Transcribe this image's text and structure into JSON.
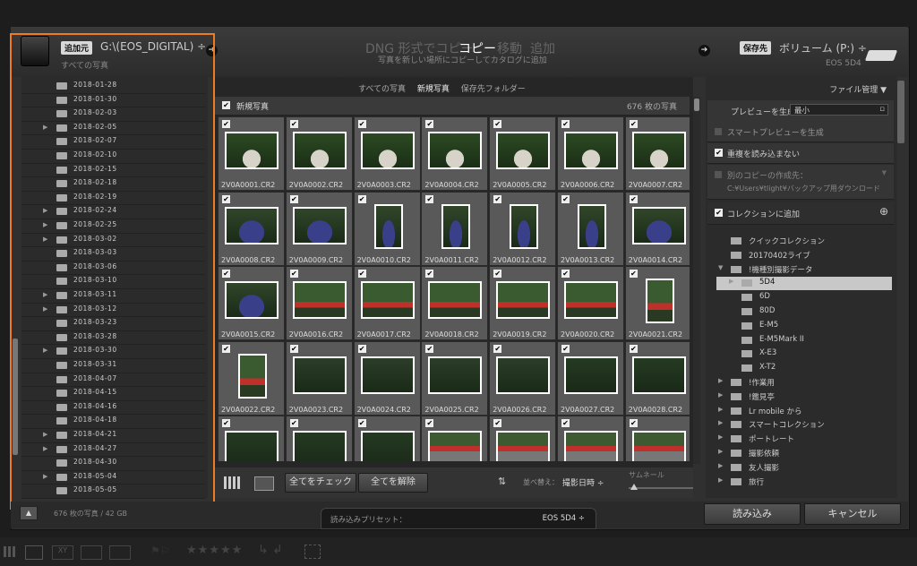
{
  "header": {
    "source_badge": "追加元",
    "source_path": "G:\\(EOS_DIGITAL) ÷",
    "source_sub": "すべての写真",
    "mode_dng": "DNG 形式でコピー",
    "mode_copy": "コピー",
    "mode_move": "移動",
    "mode_add": "追加",
    "mode_desc": "写真を新しい場所にコピーしてカタログに追加",
    "dest_badge": "保存先",
    "dest_path": "ボリューム (P:) ÷",
    "dest_sub": "EOS 5D4"
  },
  "folders": [
    {
      "label": "2018-01-28",
      "expand": false
    },
    {
      "label": "2018-01-30",
      "expand": false
    },
    {
      "label": "2018-02-03",
      "expand": false
    },
    {
      "label": "2018-02-05",
      "expand": true
    },
    {
      "label": "2018-02-07",
      "expand": false
    },
    {
      "label": "2018-02-10",
      "expand": false
    },
    {
      "label": "2018-02-15",
      "expand": false
    },
    {
      "label": "2018-02-18",
      "expand": false
    },
    {
      "label": "2018-02-19",
      "expand": false
    },
    {
      "label": "2018-02-24",
      "expand": true
    },
    {
      "label": "2018-02-25",
      "expand": true
    },
    {
      "label": "2018-03-02",
      "expand": true
    },
    {
      "label": "2018-03-03",
      "expand": false
    },
    {
      "label": "2018-03-06",
      "expand": false
    },
    {
      "label": "2018-03-10",
      "expand": false
    },
    {
      "label": "2018-03-11",
      "expand": true
    },
    {
      "label": "2018-03-12",
      "expand": true
    },
    {
      "label": "2018-03-23",
      "expand": false
    },
    {
      "label": "2018-03-28",
      "expand": false
    },
    {
      "label": "2018-03-30",
      "expand": true
    },
    {
      "label": "2018-03-31",
      "expand": false
    },
    {
      "label": "2018-04-07",
      "expand": false
    },
    {
      "label": "2018-04-15",
      "expand": false
    },
    {
      "label": "2018-04-16",
      "expand": false
    },
    {
      "label": "2018-04-18",
      "expand": false
    },
    {
      "label": "2018-04-21",
      "expand": true
    },
    {
      "label": "2018-04-27",
      "expand": true
    },
    {
      "label": "2018-04-30",
      "expand": false
    },
    {
      "label": "2018-05-04",
      "expand": true
    },
    {
      "label": "2018-05-05",
      "expand": false
    }
  ],
  "center": {
    "tab_all": "すべての写真",
    "tab_new": "新規写真",
    "tab_dest": "保存先フォルダー",
    "section_label": "新規写真",
    "count_label": "676 枚の写真",
    "photos": [
      {
        "name": "2V0A0001.CR2",
        "kind": "car",
        "portrait": false
      },
      {
        "name": "2V0A0002.CR2",
        "kind": "car",
        "portrait": false
      },
      {
        "name": "2V0A0003.CR2",
        "kind": "car",
        "portrait": false
      },
      {
        "name": "2V0A0004.CR2",
        "kind": "car",
        "portrait": false
      },
      {
        "name": "2V0A0005.CR2",
        "kind": "car",
        "portrait": false
      },
      {
        "name": "2V0A0006.CR2",
        "kind": "car",
        "portrait": false
      },
      {
        "name": "2V0A0007.CR2",
        "kind": "car",
        "portrait": false
      },
      {
        "name": "2V0A0008.CR2",
        "kind": "blue",
        "portrait": false
      },
      {
        "name": "2V0A0009.CR2",
        "kind": "blue",
        "portrait": false
      },
      {
        "name": "2V0A0010.CR2",
        "kind": "blue",
        "portrait": true
      },
      {
        "name": "2V0A0011.CR2",
        "kind": "blue",
        "portrait": true
      },
      {
        "name": "2V0A0012.CR2",
        "kind": "blue",
        "portrait": true
      },
      {
        "name": "2V0A0013.CR2",
        "kind": "blue",
        "portrait": true
      },
      {
        "name": "2V0A0014.CR2",
        "kind": "blue",
        "portrait": false
      },
      {
        "name": "2V0A0015.CR2",
        "kind": "blue",
        "portrait": false
      },
      {
        "name": "2V0A0016.CR2",
        "kind": "bridge",
        "portrait": false
      },
      {
        "name": "2V0A0017.CR2",
        "kind": "bridge",
        "portrait": false
      },
      {
        "name": "2V0A0018.CR2",
        "kind": "bridge",
        "portrait": false
      },
      {
        "name": "2V0A0019.CR2",
        "kind": "bridge",
        "portrait": false
      },
      {
        "name": "2V0A0020.CR2",
        "kind": "bridge",
        "portrait": false
      },
      {
        "name": "2V0A0021.CR2",
        "kind": "bridge",
        "portrait": true
      },
      {
        "name": "2V0A0022.CR2",
        "kind": "bridge",
        "portrait": true
      },
      {
        "name": "2V0A0023.CR2",
        "kind": "bike",
        "portrait": false
      },
      {
        "name": "2V0A0024.CR2",
        "kind": "bike",
        "portrait": false
      },
      {
        "name": "2V0A0025.CR2",
        "kind": "bike",
        "portrait": false
      },
      {
        "name": "2V0A0026.CR2",
        "kind": "bike",
        "portrait": false
      },
      {
        "name": "2V0A0027.CR2",
        "kind": "leaf",
        "portrait": false
      },
      {
        "name": "2V0A0028.CR2",
        "kind": "leaf",
        "portrait": false
      },
      {
        "name": "",
        "kind": "leaf",
        "portrait": false
      },
      {
        "name": "",
        "kind": "leaf",
        "portrait": false
      },
      {
        "name": "",
        "kind": "leaf",
        "portrait": false
      },
      {
        "name": "",
        "kind": "path",
        "portrait": false
      },
      {
        "name": "",
        "kind": "path",
        "portrait": false
      },
      {
        "name": "",
        "kind": "path",
        "portrait": false
      },
      {
        "name": "",
        "kind": "path",
        "portrait": false
      }
    ],
    "check_all": "全てをチェック",
    "uncheck_all": "全てを解除",
    "sort_label": "並べ替え：",
    "sort_value": "撮影日時 ÷",
    "thumb_label": "サムネール"
  },
  "right": {
    "panel_title": "ファイル管理",
    "preview_label": "プレビューを生成",
    "preview_value": "最小",
    "smart_preview": "スマートプレビューを生成",
    "no_dup": "重複を読み込まない",
    "second_copy": "別のコピーの作成先：",
    "second_copy_path": "C:¥Users¥tlight¥バックアップ用ダウンロード",
    "add_collection": "コレクションに追加",
    "collections": [
      {
        "label": "クイックコレクション",
        "depth": 1,
        "tri": "",
        "sel": false
      },
      {
        "label": "20170402ライブ",
        "depth": 1,
        "tri": "",
        "sel": false
      },
      {
        "label": "!機種別撮影データ",
        "depth": 1,
        "tri": "▼",
        "sel": false
      },
      {
        "label": "5D4",
        "depth": 2,
        "tri": "▶",
        "sel": true
      },
      {
        "label": "6D",
        "depth": 2,
        "tri": "",
        "sel": false
      },
      {
        "label": "80D",
        "depth": 2,
        "tri": "",
        "sel": false
      },
      {
        "label": "E-M5",
        "depth": 2,
        "tri": "",
        "sel": false
      },
      {
        "label": "E-M5Mark II",
        "depth": 2,
        "tri": "",
        "sel": false
      },
      {
        "label": "X-E3",
        "depth": 2,
        "tri": "",
        "sel": false
      },
      {
        "label": "X-T2",
        "depth": 2,
        "tri": "",
        "sel": false
      },
      {
        "label": "!作業用",
        "depth": 1,
        "tri": "▶",
        "sel": false
      },
      {
        "label": "!鑑見亭",
        "depth": 1,
        "tri": "▶",
        "sel": false
      },
      {
        "label": "Lr mobile から",
        "depth": 1,
        "tri": "▶",
        "sel": false
      },
      {
        "label": "スマートコレクション",
        "depth": 1,
        "tri": "▶",
        "sel": false
      },
      {
        "label": "ポートレート",
        "depth": 1,
        "tri": "▶",
        "sel": false
      },
      {
        "label": "撮影依頼",
        "depth": 1,
        "tri": "▶",
        "sel": false
      },
      {
        "label": "友人撮影",
        "depth": 1,
        "tri": "▶",
        "sel": false
      },
      {
        "label": "旅行",
        "depth": 1,
        "tri": "▶",
        "sel": false
      }
    ]
  },
  "bottom": {
    "status": "676 枚の写真 / 42 GB",
    "preset_label": "読み込みプリセット：",
    "preset_value": "EOS 5D4 ÷",
    "import_btn": "読み込み",
    "cancel_btn": "キャンセル"
  }
}
